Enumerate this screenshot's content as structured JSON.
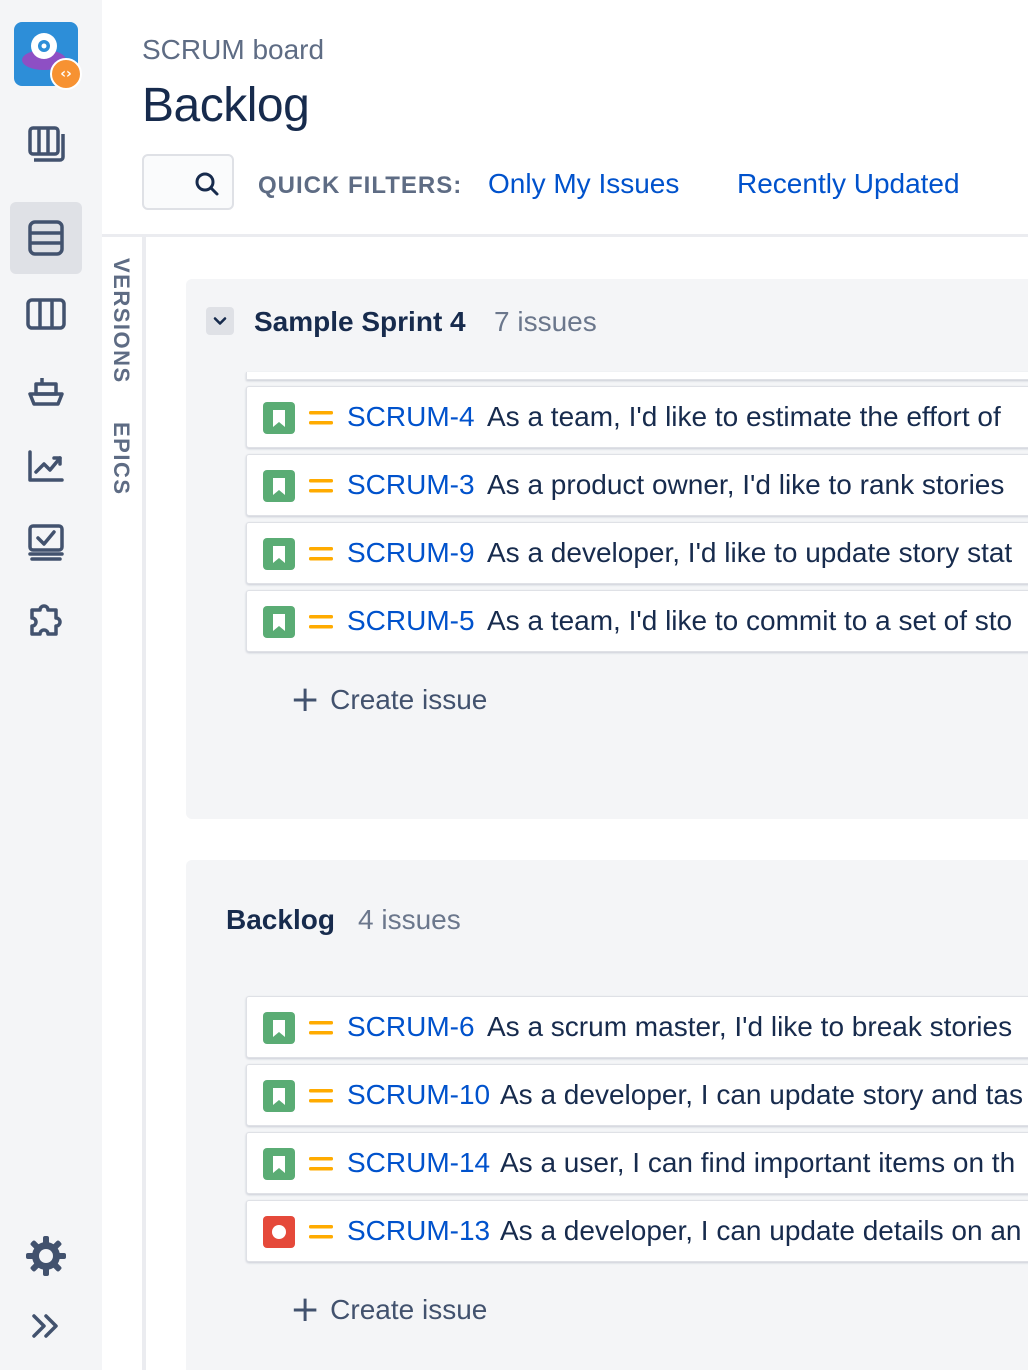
{
  "header": {
    "breadcrumb": "SCRUM board",
    "title": "Backlog",
    "quick_filters_label": "QUICK FILTERS:",
    "quick_filters": [
      "Only My Issues",
      "Recently Updated"
    ]
  },
  "nav": {
    "items": [
      "backlog-list-icon",
      "backlog-icon",
      "board-icon",
      "releases-icon",
      "reports-icon",
      "issues-icon",
      "add-ons-icon",
      "settings-icon",
      "expand-icon"
    ],
    "active": "backlog-icon"
  },
  "side_tabs": [
    "VERSIONS",
    "EPICS"
  ],
  "sprint": {
    "name": "Sample Sprint 4",
    "count": "7 issues",
    "issues": [
      {
        "key": "SCRUM-4",
        "summary": "As a team, I'd like to estimate the effort of",
        "type": "story"
      },
      {
        "key": "SCRUM-3",
        "summary": "As a product owner, I'd like to rank stories",
        "type": "story"
      },
      {
        "key": "SCRUM-9",
        "summary": "As a developer, I'd like to update story stat",
        "type": "story"
      },
      {
        "key": "SCRUM-5",
        "summary": "As a team, I'd like to commit to a set of sto",
        "type": "story"
      }
    ],
    "create_label": "Create issue"
  },
  "backlog": {
    "name": "Backlog",
    "count": "4 issues",
    "issues": [
      {
        "key": "SCRUM-6",
        "summary": "As a scrum master, I'd like to break stories",
        "type": "story"
      },
      {
        "key": "SCRUM-10",
        "summary": "As a developer, I can update story and tas",
        "type": "story"
      },
      {
        "key": "SCRUM-14",
        "summary": "As a user, I can find important items on th",
        "type": "story"
      },
      {
        "key": "SCRUM-13",
        "summary": "As a developer, I can update details on an",
        "type": "bug"
      }
    ],
    "create_label": "Create issue"
  },
  "colors": {
    "link": "#0052cc",
    "story": "#5aac74",
    "bug": "#e5493a",
    "priority_medium": "#ffab00"
  }
}
